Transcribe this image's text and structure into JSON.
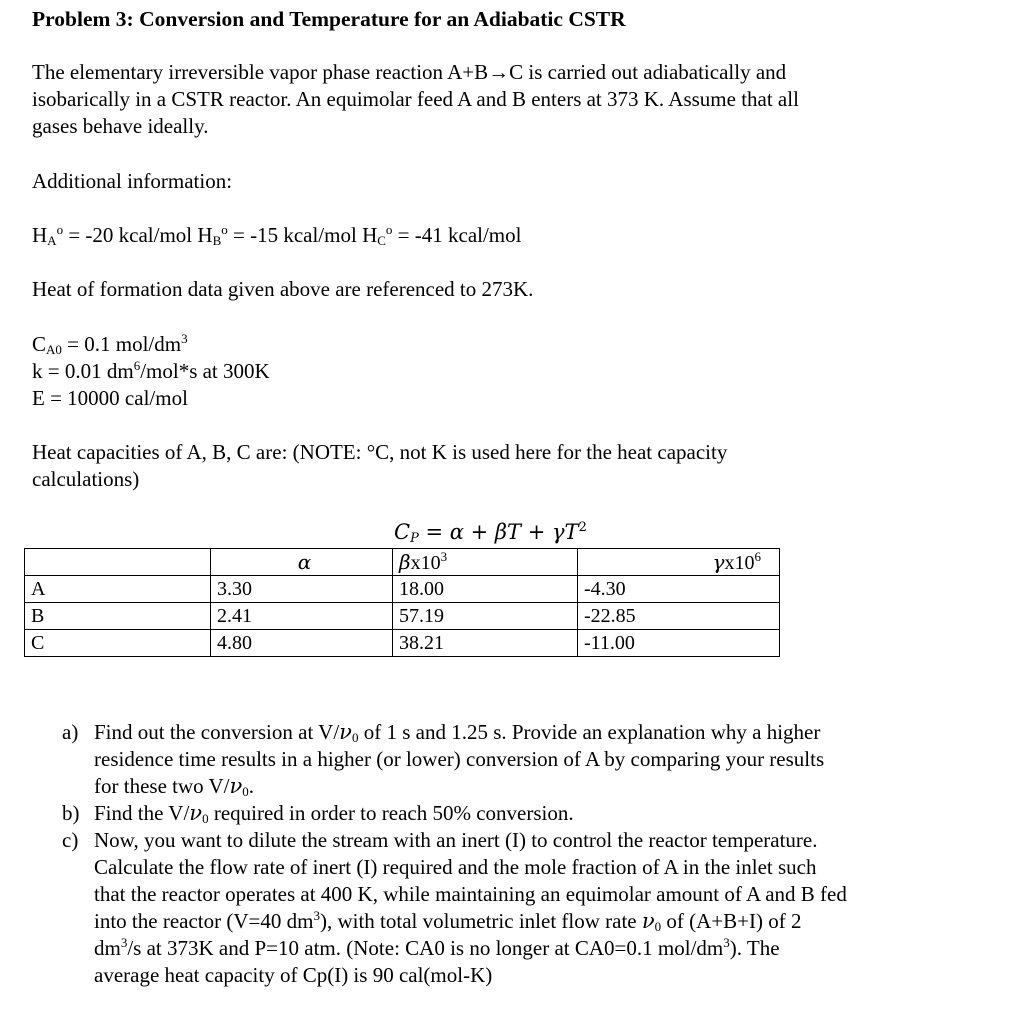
{
  "title": "Problem 3: Conversion and Temperature for an Adiabatic CSTR",
  "intro": [
    "The elementary irreversible vapor phase reaction A+B→C is carried out adiabatically and",
    "isobarically in a CSTR reactor. An equimolar feed A and B enters at 373 K. Assume that all",
    "gases behave ideally."
  ],
  "additional_info_label": "Additional information:",
  "heats_of_formation": [
    {
      "symbol": "H",
      "sub": "A",
      "sup": "o",
      "value": " = -20 kcal/mol "
    },
    {
      "symbol": "H",
      "sub": "B",
      "sup": "o",
      "value": " = -15 kcal/mol "
    },
    {
      "symbol": "H",
      "sub": "C",
      "sup": "o",
      "value": " = -41 kcal/mol"
    }
  ],
  "reference_note": "Heat of formation data given above are referenced to 273K.",
  "params": {
    "ca0": {
      "symbol": "C",
      "sub": "A0",
      "text": " = 0.1 mol/dm",
      "sup": "3"
    },
    "k": {
      "prefix": "k = 0.01 dm",
      "sup": "6",
      "suffix": "/mol*s at 300K"
    },
    "E": "E = 10000 cal/mol"
  },
  "heat_capacity_intro": [
    "Heat capacities of A, B, C are: (NOTE: °C, not K is used here for the heat capacity",
    "calculations)"
  ],
  "formula": {
    "lhs": "C",
    "lhs_sub": "P",
    "rhs": " = α + βT + γT",
    "rhs_sup": "2"
  },
  "table": {
    "headers": [
      "",
      "α",
      "β",
      "γ"
    ],
    "header_suffix": [
      "",
      "",
      "x10",
      "x10"
    ],
    "header_exp": [
      "",
      "",
      "3",
      "6"
    ],
    "rows": [
      [
        "A",
        "3.30",
        "18.00",
        "-4.30"
      ],
      [
        "B",
        "2.41",
        "57.19",
        "-22.85"
      ],
      [
        "C",
        "4.80",
        "38.21",
        "-11.00"
      ]
    ]
  },
  "questions": [
    {
      "label": "a)",
      "lines": [
        [
          "Find out the conversion at V/",
          "ν",
          "0",
          " of 1 s and 1.25 s. Provide an explanation why a higher"
        ],
        [
          "residence time results in a higher (or lower) conversion of A by comparing your results"
        ],
        [
          "for these two V/",
          "ν",
          "0",
          "."
        ]
      ]
    },
    {
      "label": "b)",
      "lines": [
        [
          "Find the V/",
          "ν",
          "0",
          " required in order to reach 50% conversion."
        ]
      ]
    },
    {
      "label": "c)",
      "lines": [
        [
          "Now, you want to dilute the stream with an inert (I) to control the reactor temperature."
        ],
        [
          "Calculate the flow rate of inert (I) required and the mole fraction of A in the inlet such"
        ],
        [
          "that the reactor operates at 400 K, while maintaining an equimolar amount of A and B fed"
        ],
        [
          "into the reactor (V=40 dm",
          "3",
          "), with total volumetric inlet flow rate ",
          "ν",
          "0",
          " of (A+B+I) of 2"
        ],
        [
          "dm",
          "3",
          "/s at 373K and P=10 atm. (Note: CA0 is no longer at CA0=0.1 mol/dm",
          "3",
          "). The"
        ],
        [
          "average heat capacity of Cp(I) is 90 cal(mol-K)"
        ]
      ]
    }
  ]
}
